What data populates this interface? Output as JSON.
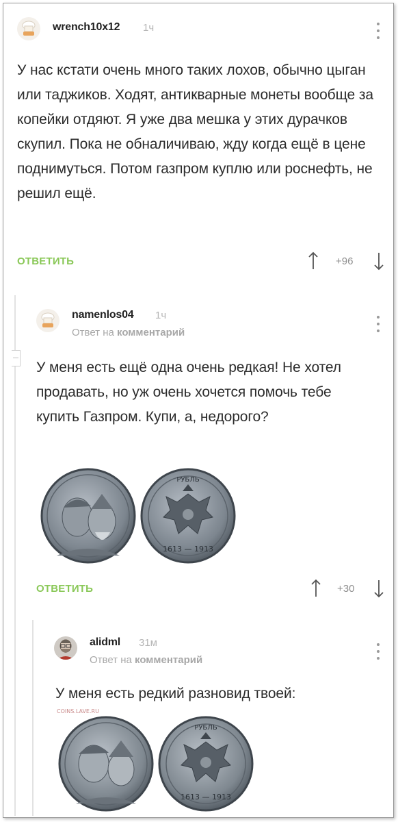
{
  "comments": [
    {
      "author": "wrench10x12",
      "time": "1ч",
      "text": "У нас кстати очень много таких лохов, обычно цыган или таджиков. Ходят, антикварные монеты вообще за копейки отдяют. Я уже два мешка у этих дурачков скупил. Пока не обналичиваю, жду когда ещё в цене поднимуться. Потом газпром куплю или роснефть, не решил ещё.",
      "reply_label": "ОТВЕТИТЬ",
      "score": "+96"
    },
    {
      "author": "namenlos04",
      "time": "1ч",
      "reply_prefix": "Ответ на",
      "reply_target": "комментарий",
      "text": "У меня есть ещё одна очень редкая! Не хотел продавать, но уж очень хочется помочь тебе купить Газпром. Купи, а, недорого?",
      "coin_obverse_text": "",
      "coin_reverse_legend": "РУБЛЬ",
      "coin_reverse_years": "1613 — 1913",
      "reply_label": "ОТВЕТИТЬ",
      "score": "+30"
    },
    {
      "author": "alidml",
      "time": "31м",
      "reply_prefix": "Ответ на",
      "reply_target": "комментарий",
      "text": "У меня есть редкий разновид твоей:",
      "image_watermark": "COINS.LAVE.RU",
      "coin_reverse_legend": "РУБЛЬ",
      "coin_reverse_years": "1613 — 1913"
    }
  ],
  "colors": {
    "accent_green": "#8ac858",
    "muted": "#a8a8a8",
    "text": "#2c2c2c"
  },
  "icons": [
    "chef-hat-avatar",
    "bearded-man-avatar",
    "more-options-icon",
    "arrow-up-icon",
    "arrow-down-icon"
  ]
}
